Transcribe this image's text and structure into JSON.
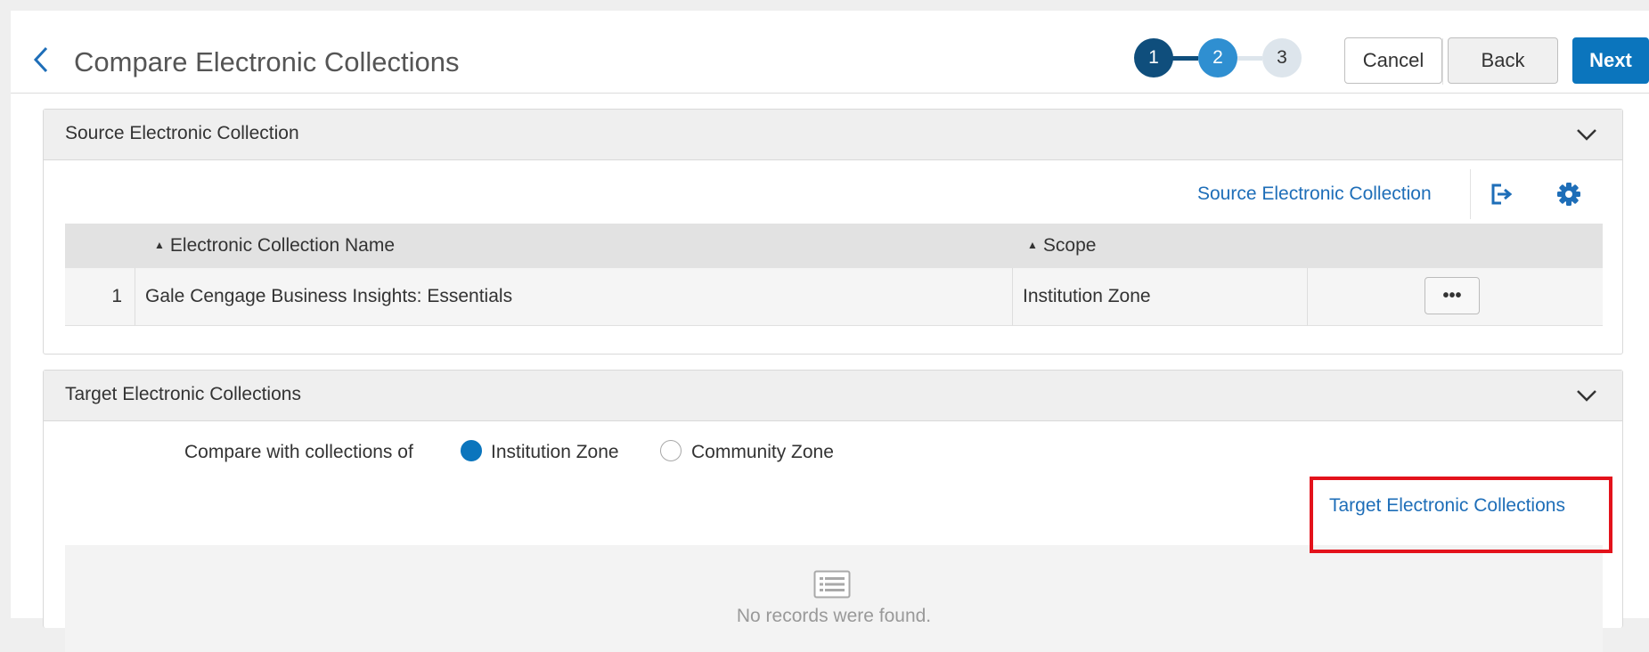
{
  "header": {
    "title": "Compare Electronic Collections",
    "steps": [
      "1",
      "2",
      "3"
    ],
    "cancel_label": "Cancel",
    "back_label": "Back",
    "next_label": "Next"
  },
  "source_panel": {
    "title": "Source Electronic Collection",
    "toolbar_link": "Source Electronic Collection",
    "columns": [
      "Electronic Collection Name",
      "Scope"
    ],
    "rows": [
      {
        "index": "1",
        "name": "Gale Cengage Business Insights: Essentials",
        "scope": "Institution Zone",
        "actions": "•••"
      }
    ]
  },
  "target_panel": {
    "title": "Target Electronic Collections",
    "compare_label": "Compare with collections of",
    "options": [
      "Institution Zone",
      "Community Zone"
    ],
    "selected": "Institution Zone",
    "toolbar_link": "Target Electronic Collections",
    "empty_text": "No records were found."
  },
  "colors": {
    "primary": "#0b75bd",
    "link": "#1e6eb8",
    "step_done": "#0f4e7c",
    "step_active": "#2f8fd1",
    "step_pending": "#dde5ec",
    "highlight": "#e3121b"
  }
}
